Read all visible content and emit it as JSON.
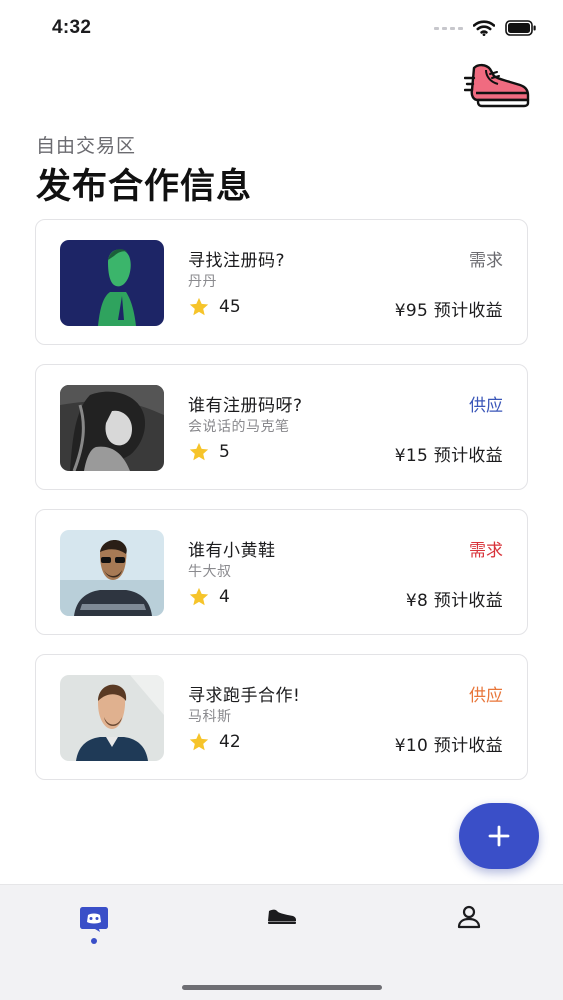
{
  "status_bar": {
    "time": "4:32"
  },
  "header": {
    "subtitle": "自由交易区",
    "title": "发布合作信息"
  },
  "cards": [
    {
      "title": "寻找注册码?",
      "author": "丹丹",
      "rating": "45",
      "tag": "需求",
      "tag_color": "#6b6b70",
      "earnings": "¥95 预计收益"
    },
    {
      "title": "谁有注册码呀?",
      "author": "会说话的马克笔",
      "rating": "5",
      "tag": "供应",
      "tag_color": "#3a56b8",
      "earnings": "¥15 预计收益"
    },
    {
      "title": "谁有小黄鞋",
      "author": "牛大叔",
      "rating": "4",
      "tag": "需求",
      "tag_color": "#d8333a",
      "earnings": "¥8 预计收益"
    },
    {
      "title": "寻求跑手合作!",
      "author": "马科斯",
      "rating": "42",
      "tag": "供应",
      "tag_color": "#e8763a",
      "earnings": "¥10 预计收益"
    }
  ],
  "fab": {
    "icon": "plus-icon",
    "color": "#3a4fc8"
  },
  "tab_bar": {
    "items": [
      {
        "icon": "chat-icon",
        "active": true
      },
      {
        "icon": "sneaker-icon",
        "active": false
      },
      {
        "icon": "profile-icon",
        "active": false
      }
    ]
  }
}
